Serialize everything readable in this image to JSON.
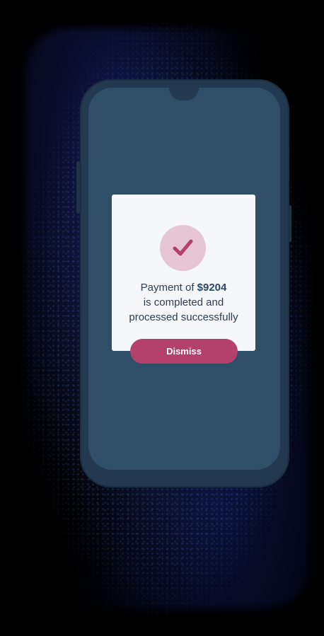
{
  "dialog": {
    "message_prefix": "Payment of ",
    "amount": "$9204",
    "message_line2": "is completed and",
    "message_line3": "processed successfully",
    "dismiss_label": "Dismiss"
  },
  "icons": {
    "success": "checkmark-icon"
  },
  "colors": {
    "phone_body": "#22394f",
    "screen": "#2f4f68",
    "dialog_bg": "#f5f7fb",
    "badge_bg": "#e6c6d3",
    "accent": "#b3416b",
    "text": "#2b3e52"
  }
}
